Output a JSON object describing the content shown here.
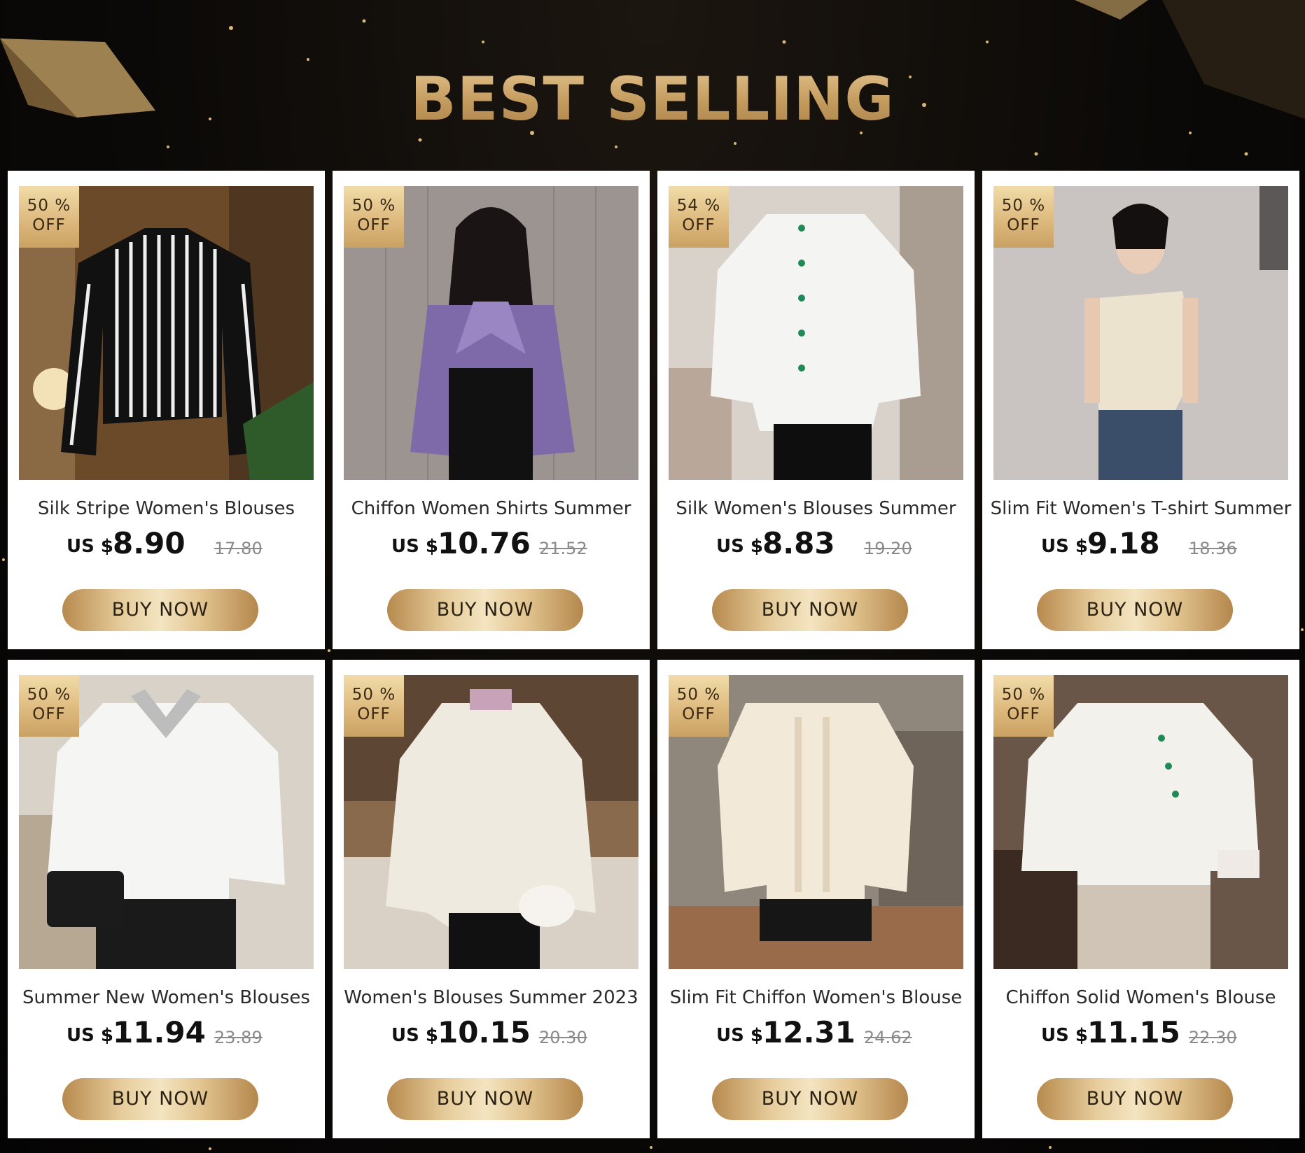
{
  "header": {
    "title": "BEST SELLING"
  },
  "colors": {
    "accent_gold": "#c9a46a",
    "background": "#0a0806",
    "card": "#ffffff"
  },
  "products": [
    {
      "name": "Silk Stripe Women's Blouses",
      "currency": "US $",
      "price": "8.90",
      "old_price": "17.80",
      "discount_pct": "50 %",
      "discount_off": "OFF",
      "button": "BUY NOW"
    },
    {
      "name": "Chiffon Women Shirts Summer",
      "currency": "US $",
      "price": "10.76",
      "old_price": "21.52",
      "discount_pct": "50 %",
      "discount_off": "OFF",
      "button": "BUY NOW"
    },
    {
      "name": "Silk Women's Blouses Summer",
      "currency": "US $",
      "price": "8.83",
      "old_price": "19.20",
      "discount_pct": "54 %",
      "discount_off": "OFF",
      "button": "BUY NOW"
    },
    {
      "name": "Slim Fit Women's T-shirt Summer",
      "currency": "US $",
      "price": "9.18",
      "old_price": "18.36",
      "discount_pct": "50 %",
      "discount_off": "OFF",
      "button": "BUY NOW"
    },
    {
      "name": "Summer New Women's Blouses",
      "currency": "US $",
      "price": "11.94",
      "old_price": "23.89",
      "discount_pct": "50 %",
      "discount_off": "OFF",
      "button": "BUY NOW"
    },
    {
      "name": "Women's Blouses Summer 2023",
      "currency": "US $",
      "price": "10.15",
      "old_price": "20.30",
      "discount_pct": "50 %",
      "discount_off": "OFF",
      "button": "BUY NOW"
    },
    {
      "name": "Slim Fit Chiffon Women's Blouse",
      "currency": "US $",
      "price": "12.31",
      "old_price": "24.62",
      "discount_pct": "50 %",
      "discount_off": "OFF",
      "button": "BUY NOW"
    },
    {
      "name": "Chiffon Solid Women's Blouse",
      "currency": "US $",
      "price": "11.15",
      "old_price": "22.30",
      "discount_pct": "50 %",
      "discount_off": "OFF",
      "button": "BUY NOW"
    }
  ]
}
